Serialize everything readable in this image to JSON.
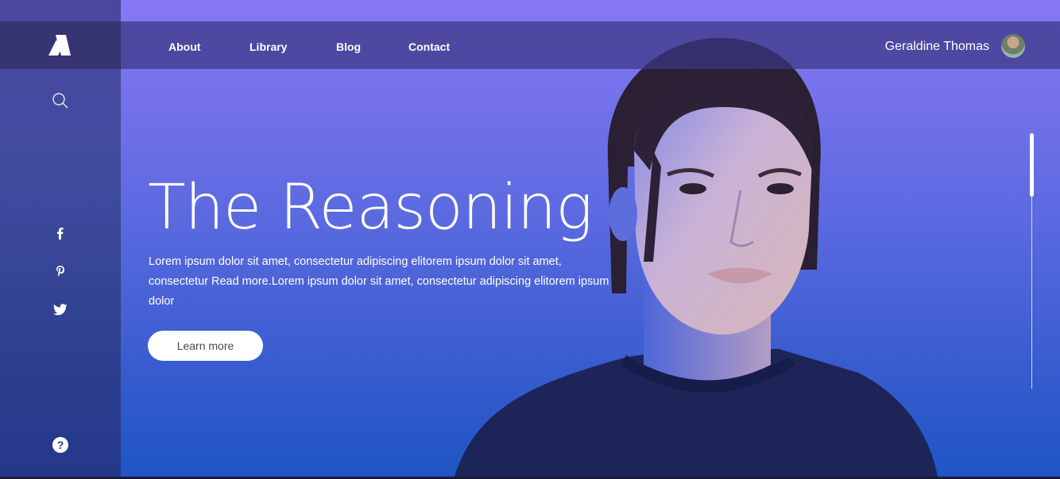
{
  "nav": {
    "items": [
      {
        "label": "About"
      },
      {
        "label": "Library"
      },
      {
        "label": "Blog"
      },
      {
        "label": "Contact"
      }
    ],
    "user_name": "Geraldine Thomas"
  },
  "sidebar": {
    "icons": [
      "logo-icon",
      "search-icon",
      "facebook-icon",
      "pinterest-icon",
      "twitter-icon",
      "help-icon"
    ]
  },
  "hero": {
    "title": "The Reasoning",
    "body_line1": "Lorem ipsum dolor sit amet, consectetur adipiscing elitorem ipsum dolor sit amet,",
    "body_line2": "consectetur Read more.Lorem ipsum dolor sit amet, consectetur adipiscing elitorem ipsum",
    "body_line3": "dolor",
    "button_label": "Learn more"
  },
  "colors": {
    "gradient_top": "#8777f4",
    "gradient_bottom": "#1f55c4",
    "sidebar": "#3f4b9e",
    "logo_box": "#363473"
  }
}
